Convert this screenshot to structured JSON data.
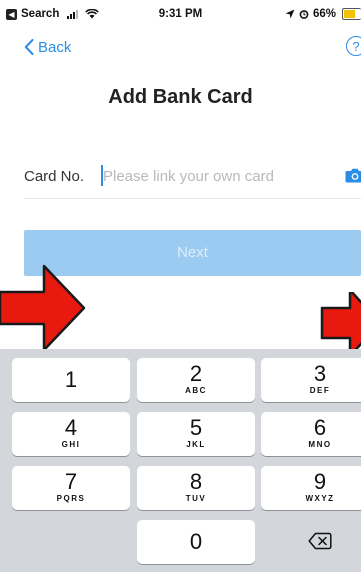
{
  "status_bar": {
    "back_app": "Search",
    "time": "9:31 PM",
    "battery": "66%"
  },
  "nav": {
    "back_label": "Back",
    "help_symbol": "?"
  },
  "page_title": "Add Bank Card",
  "card_field": {
    "label": "Card No.",
    "placeholder": "Please link your own card",
    "value": ""
  },
  "next_button": "Next",
  "keypad": {
    "keys": [
      {
        "num": "1",
        "letters": ""
      },
      {
        "num": "2",
        "letters": "ABC"
      },
      {
        "num": "3",
        "letters": "DEF"
      },
      {
        "num": "4",
        "letters": "GHI"
      },
      {
        "num": "5",
        "letters": "JKL"
      },
      {
        "num": "6",
        "letters": "MNO"
      },
      {
        "num": "7",
        "letters": "PQRS"
      },
      {
        "num": "8",
        "letters": "TUV"
      },
      {
        "num": "9",
        "letters": "WXYZ"
      },
      {
        "num": "0",
        "letters": ""
      }
    ]
  },
  "colors": {
    "accent": "#2b8de6",
    "next_disabled": "#9ccbf2",
    "annotation_arrow": "#e8190f"
  },
  "icons": [
    "signal-icon",
    "wifi-icon",
    "location-icon",
    "alarm-icon",
    "battery-icon",
    "chevron-left-icon",
    "help-icon",
    "camera-icon",
    "backspace-icon"
  ]
}
